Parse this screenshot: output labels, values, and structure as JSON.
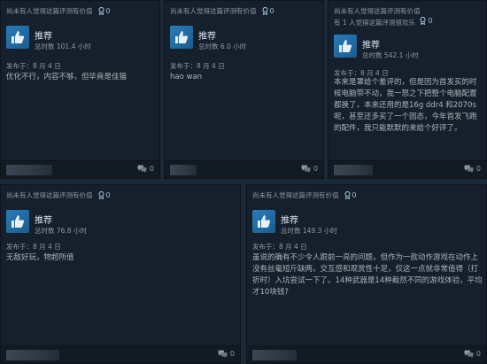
{
  "reviews": [
    {
      "helpful": "尚未有人觉得这篇评测有价值",
      "award_count": "0",
      "recommend": "推荐",
      "hours": "总时数 101.4 小时",
      "posted": "发布于：8 月 4 日",
      "text": "优化不行，内容不够，但毕竟是佳猫",
      "comments": "0"
    },
    {
      "helpful": "尚未有人觉得这篇评测有价值",
      "award_count": "0",
      "recommend": "推荐",
      "hours": "总时数 6.0 小时",
      "posted": "发布于：8 月 4 日",
      "text": "hao wan",
      "comments": "0"
    },
    {
      "helpful": "尚未有人觉得这篇评测有价值",
      "helpful_sub": "有 1 人觉得这篇评测很欢乐",
      "award_count": "0",
      "recommend": "推荐",
      "hours": "总时数 542.1 小时",
      "posted": "发布于：8 月 4 日",
      "text": "本来是罩给个差评的，但是因为首发买的时候电脑带不动，我一怒之下把整个电脑配置都换了，本来还用的是16g ddr4 和2070s呢，甚至还多买了一个固态，今年首发飞跑的配件，我只能默默的来给个好评了。",
      "comments": "0"
    },
    {
      "helpful": "尚未有人觉得这篇评测有价值",
      "award_count": "0",
      "recommend": "推荐",
      "hours": "总时数 76.8 小时",
      "posted": "发布于：8 月 4 日",
      "text": "无敌好玩，物超所值",
      "comments": "0"
    },
    {
      "helpful": "尚未有人觉得这篇评测有价值",
      "award_count": "0",
      "recommend": "推荐",
      "hours": "总时数 149.3 小时",
      "posted": "发布于：8 月 4 日",
      "text": "虽说的确有不少令人跟前一亮的问题，但作为一款动作游戏在动作上没有丝毫短斤缺两，交互感和观赏性十足，仅这一点就非常值得（打折时）入坑尝试一下了。14种武器是14种截然不同的游戏体验，平均才10块钱?",
      "comments": "0"
    }
  ],
  "colors": {
    "background": "#1b2838",
    "card": "#16202d",
    "thumb": "#2a7bb8",
    "text": "#acb2b8"
  },
  "icons": {
    "thumb": "thumbs-up-icon",
    "award": "award-icon",
    "comment": "comment-icon"
  }
}
